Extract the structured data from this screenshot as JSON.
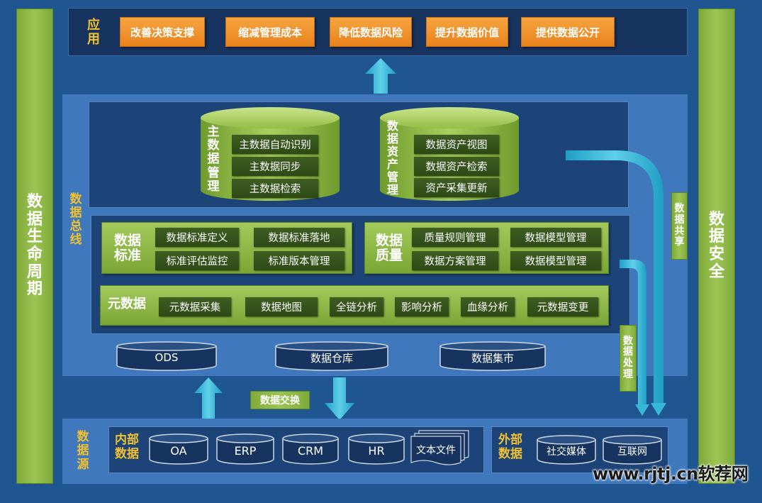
{
  "left_bar": "数据生命周期",
  "right_bar": "数据安全",
  "application": {
    "label": "应用",
    "buttons": [
      "改善决策支撑",
      "缩减管理成本",
      "降低数据风险",
      "提升数据价值",
      "提供数据公开"
    ]
  },
  "data_bus": {
    "label": "数据总线",
    "master_data": {
      "title": "主数据管理",
      "items": [
        "主数据自动识别",
        "主数据同步",
        "主数据检索"
      ]
    },
    "asset_mgmt": {
      "title": "数据资产管理",
      "items": [
        "数据资产视图",
        "数据资产检索",
        "资产采集更新"
      ]
    },
    "standard": {
      "title": "数据标准",
      "items": [
        "数据标准定义",
        "数据标准落地",
        "标准评估监控",
        "标准版本管理"
      ]
    },
    "quality": {
      "title": "数据质量",
      "items": [
        "质量规则管理",
        "数据模型管理",
        "数据方案管理",
        "数据模型管理"
      ]
    },
    "metadata": {
      "title": "元数据",
      "items": [
        "元数据采集",
        "数据地图",
        "全链分析",
        "影响分析",
        "血缘分析",
        "元数据变更"
      ]
    },
    "stores": [
      "ODS",
      "数据仓库",
      "数据集市"
    ]
  },
  "data_exchange": "数据交换",
  "data_share": "数据共享",
  "data_process": "数据处理",
  "data_source": {
    "label": "数据源",
    "internal": {
      "title": "内部数据",
      "items": [
        "OA",
        "ERP",
        "CRM",
        "HR",
        "文本文件"
      ]
    },
    "external": {
      "title": "外部数据",
      "items": [
        "社交媒体",
        "互联网"
      ]
    }
  },
  "watermark": "www.rjtj.cn软荐网",
  "colors": {
    "background": "#1f5591",
    "green": "#9cc553",
    "orange": "#f19332",
    "label_yellow": "#f2c12e",
    "arrow": "#36b8d8"
  }
}
